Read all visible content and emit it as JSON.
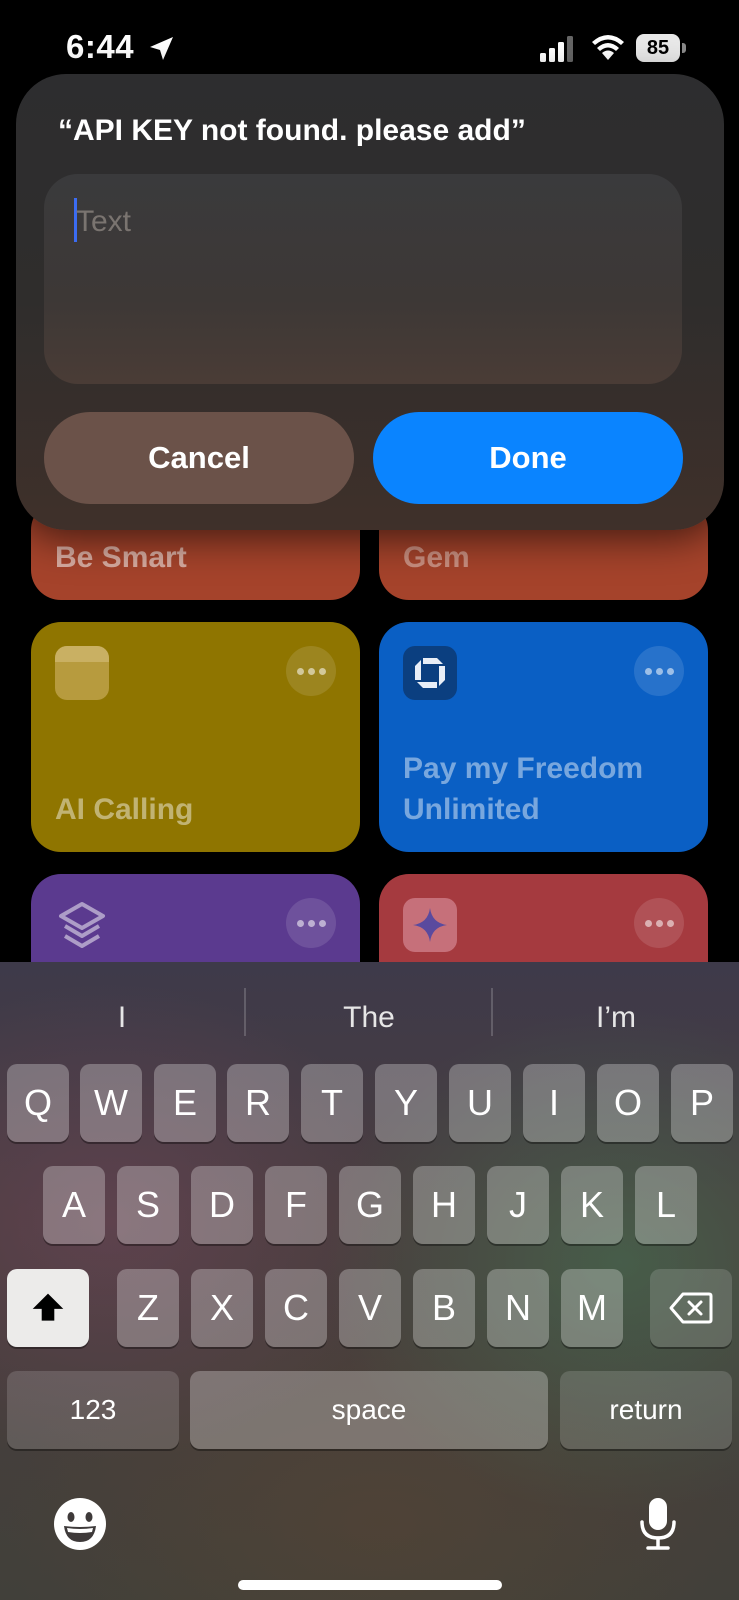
{
  "status_bar": {
    "time": "6:44",
    "battery": "85"
  },
  "dialog": {
    "title": "“API KEY not found. please add”",
    "input_placeholder": "Text",
    "input_value": "",
    "cancel_label": "Cancel",
    "done_label": "Done"
  },
  "shortcuts": [
    {
      "title": "Be Smart",
      "color": "#a5432b"
    },
    {
      "title": "Gem",
      "color": "#a5432b"
    },
    {
      "title": "AI Calling",
      "color": "#8f7500"
    },
    {
      "title": "Pay my Freedom Unlimited",
      "color": "#0a5fc4"
    },
    {
      "title": "",
      "color": "#5b3a8f"
    },
    {
      "title": "",
      "color": "#a53a3f"
    }
  ],
  "keyboard": {
    "suggestions": [
      "I",
      "The",
      "I’m"
    ],
    "row1": [
      "Q",
      "W",
      "E",
      "R",
      "T",
      "Y",
      "U",
      "I",
      "O",
      "P"
    ],
    "row2": [
      "A",
      "S",
      "D",
      "F",
      "G",
      "H",
      "J",
      "K",
      "L"
    ],
    "row3": [
      "Z",
      "X",
      "C",
      "V",
      "B",
      "N",
      "M"
    ],
    "numbers_label": "123",
    "space_label": "space",
    "return_label": "return"
  }
}
